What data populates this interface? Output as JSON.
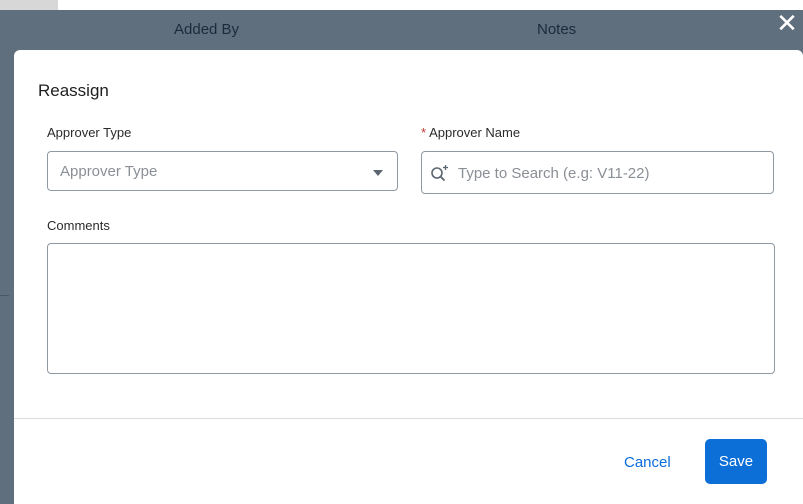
{
  "background": {
    "table_headers": [
      "Added By",
      "Notes"
    ]
  },
  "close_icon": "close-icon",
  "modal": {
    "title": "Reassign",
    "approver_type": {
      "label": "Approver Type",
      "placeholder": "Approver Type",
      "icon": "chevron-down-icon"
    },
    "approver_name": {
      "required_marker": "*",
      "label": "Approver Name",
      "placeholder": "Type to Search (e.g: V11-22)",
      "value": "",
      "icon": "search-icon"
    },
    "comments": {
      "label": "Comments",
      "value": ""
    },
    "footer": {
      "cancel_label": "Cancel",
      "save_label": "Save"
    }
  },
  "colors": {
    "overlay": "#5f6f7e",
    "primary": "#0b6fd7",
    "link": "#0b6cdb",
    "required": "#c23934"
  }
}
